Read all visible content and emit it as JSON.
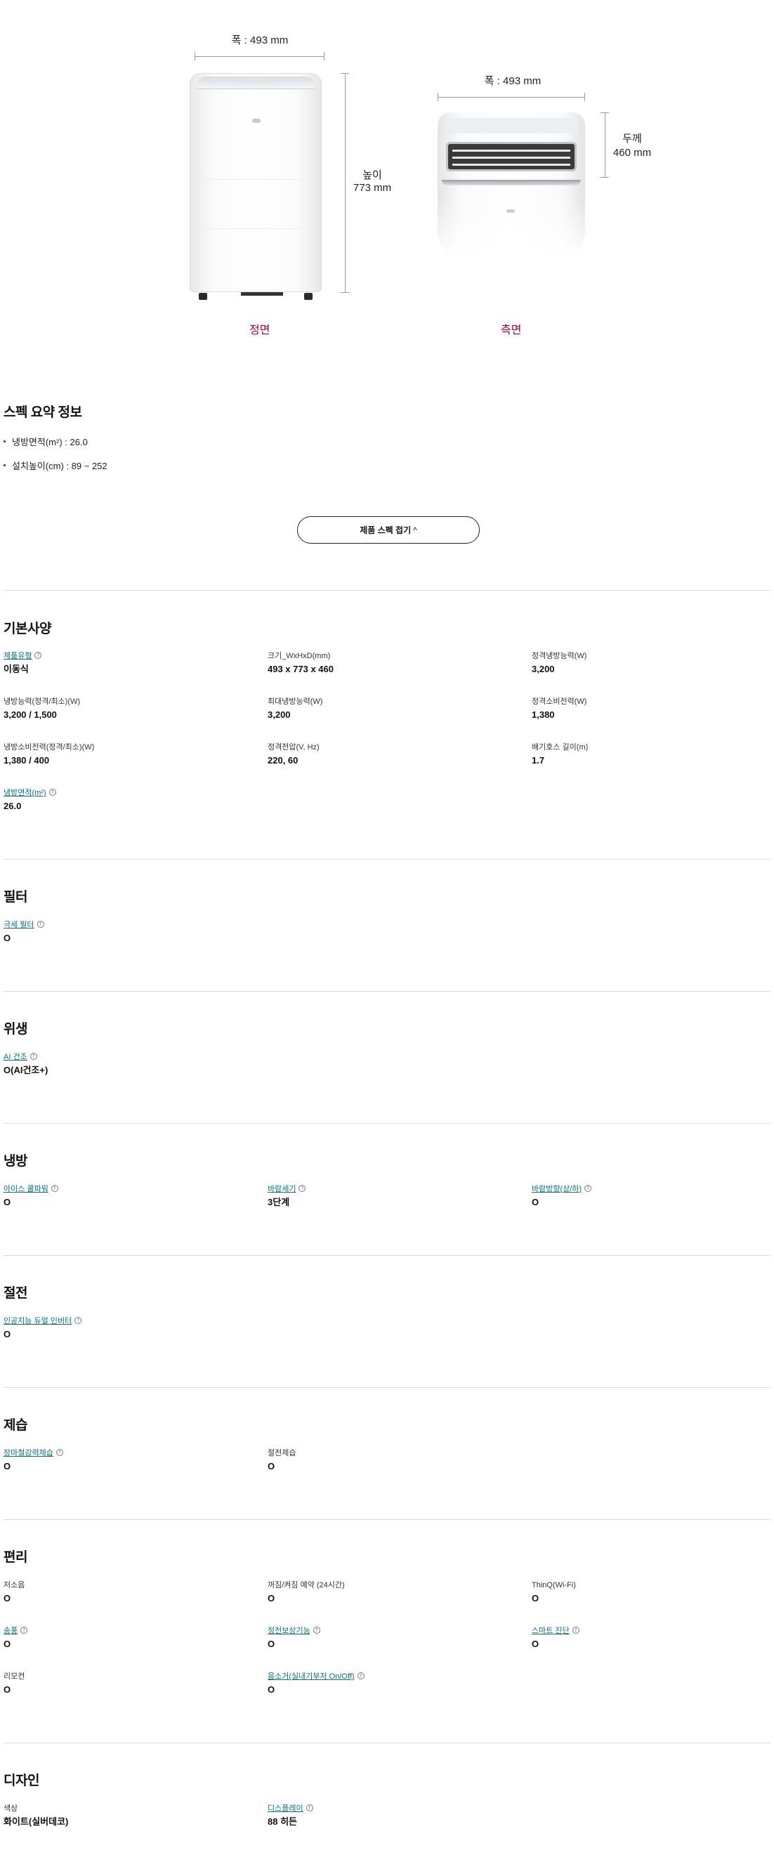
{
  "dimensions": {
    "front": {
      "width": "폭 : 493 mm",
      "height_label": "높이",
      "height_value": "773 mm",
      "view_label": "정면"
    },
    "side": {
      "width": "폭 : 493 mm",
      "depth_label": "두께",
      "depth_value": "460 mm",
      "view_label": "측면"
    }
  },
  "summary": {
    "title": "스펙 요약 정보",
    "items": [
      "냉방면적(m²) : 26.0",
      "설치높이(cm) : 89 ~ 252"
    ]
  },
  "fold_button": {
    "label": "제품 스펙 접기",
    "chevron": "^"
  },
  "sections": {
    "basic": {
      "title": "기본사양",
      "specs": [
        {
          "label": "제품유형",
          "value": "이동식"
        },
        {
          "label": "크기_WxHxD(mm)",
          "value": "493 x 773 x 460"
        },
        {
          "label": "정격냉방능력(W)",
          "value": "3,200"
        },
        {
          "label": "냉방능력(정격/최소)(W)",
          "value": "3,200 / 1,500"
        },
        {
          "label": "최대냉방능력(W)",
          "value": "3,200"
        },
        {
          "label": "정격소비전력(W)",
          "value": "1,380"
        },
        {
          "label": "냉방소비전력(정격/최소)(W)",
          "value": "1,380 / 400"
        },
        {
          "label": "정격전압(V, Hz)",
          "value": "220, 60"
        },
        {
          "label": "배기호스 길이(m)",
          "value": "1.7"
        },
        {
          "label": "냉방면적(m²)",
          "value": "26.0"
        }
      ]
    },
    "filter": {
      "title": "필터",
      "specs": [
        {
          "label": "극세 필터",
          "value": "O"
        }
      ]
    },
    "hygiene": {
      "title": "위생",
      "specs": [
        {
          "label": "AI 건조",
          "value": "O(AI건조+)"
        }
      ]
    },
    "cooling": {
      "title": "냉방",
      "specs": [
        {
          "label": "아이스 쿨파워",
          "value": "O"
        },
        {
          "label": "바람세기",
          "value": "3단계"
        },
        {
          "label": "바람방향(상/하)",
          "value": "O"
        }
      ]
    },
    "power": {
      "title": "절전",
      "specs": [
        {
          "label": "인공지능 듀얼 인버터",
          "value": "O"
        }
      ]
    },
    "dehumid": {
      "title": "제습",
      "specs": [
        {
          "label": "장마철강력제습",
          "value": "O"
        },
        {
          "label": "절전제습",
          "value": "O"
        }
      ]
    },
    "convenience": {
      "title": "편리",
      "specs": [
        {
          "label": "저소음",
          "value": "O"
        },
        {
          "label": "꺼짐/켜짐 예약 (24시간)",
          "value": "O"
        },
        {
          "label": "ThinQ(Wi-Fi)",
          "value": "O"
        },
        {
          "label": "송풍",
          "value": "O"
        },
        {
          "label": "정전보상기능",
          "value": "O"
        },
        {
          "label": "스마트 진단",
          "value": "O"
        },
        {
          "label": "리모컨",
          "value": "O"
        },
        {
          "label": "음소거(실내기부저 On/Off)",
          "value": "O"
        }
      ]
    },
    "design": {
      "title": "디자인",
      "specs": [
        {
          "label": "색상",
          "value": "화이트(실버데코)"
        },
        {
          "label": "디스플레이",
          "value": "88 히든"
        }
      ]
    }
  },
  "help_glyph": "?"
}
